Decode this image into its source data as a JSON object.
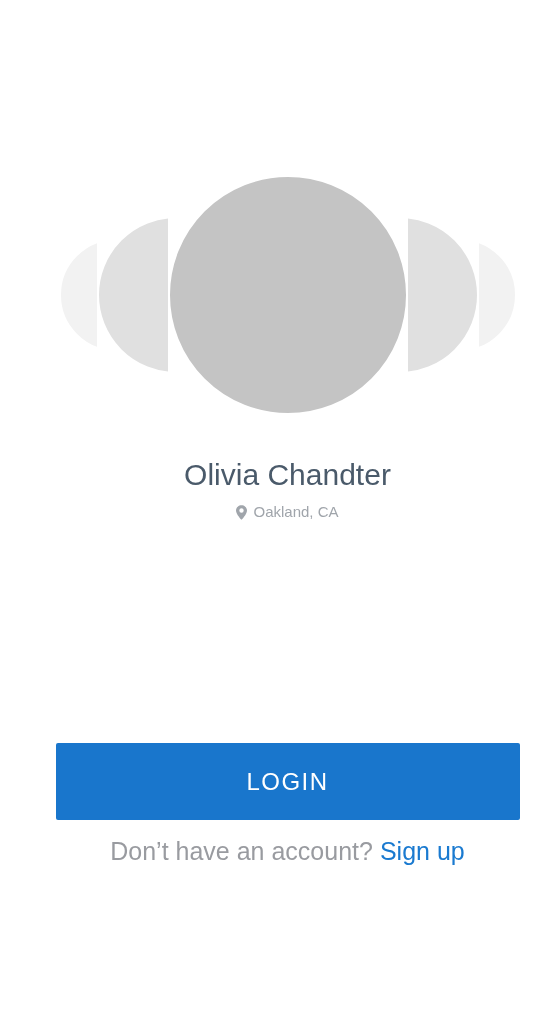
{
  "avatars": [
    {
      "selected": false
    },
    {
      "selected": false
    },
    {
      "selected": true
    },
    {
      "selected": false
    },
    {
      "selected": false
    }
  ],
  "profile": {
    "name": "Olivia Chandter",
    "location": "Oakland, CA"
  },
  "login_button": "LOGIN",
  "signup_prompt": {
    "text": "Don’t have an account?",
    "link": "Sign up"
  }
}
